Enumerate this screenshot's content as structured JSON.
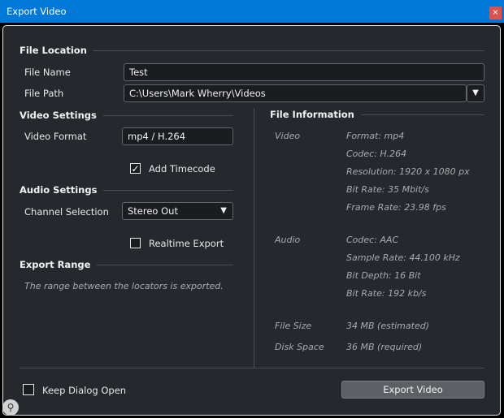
{
  "window": {
    "title": "Export Video",
    "close_icon": "×"
  },
  "file_location": {
    "heading": "File Location",
    "file_name_label": "File Name",
    "file_name_value": "Test",
    "file_path_label": "File Path",
    "file_path_value": "C:\\Users\\Mark Wherry\\Videos",
    "dropdown_icon": "▼"
  },
  "video_settings": {
    "heading": "Video Settings",
    "format_label": "Video Format",
    "format_value": "mp4 / H.264",
    "add_timecode_label": "Add Timecode",
    "add_timecode_checked": true,
    "check_glyph": "✓"
  },
  "audio_settings": {
    "heading": "Audio Settings",
    "channel_label": "Channel Selection",
    "channel_value": "Stereo Out",
    "dropdown_icon": "▼",
    "realtime_label": "Realtime Export",
    "realtime_checked": false
  },
  "export_range": {
    "heading": "Export Range",
    "description": "The range between the locators is exported."
  },
  "file_information": {
    "heading": "File Information",
    "video_label": "Video",
    "video_items": [
      "Format: mp4",
      "Codec: H.264",
      "Resolution: 1920 x 1080 px",
      "Bit Rate: 35 Mbit/s",
      "Frame Rate: 23.98 fps"
    ],
    "audio_label": "Audio",
    "audio_items": [
      "Codec: AAC",
      "Sample Rate: 44.100 kHz",
      "Bit Depth: 16 Bit",
      "Bit Rate: 192 kb/s"
    ],
    "file_size_label": "File Size",
    "file_size_value": "34 MB (estimated)",
    "disk_space_label": "Disk Space",
    "disk_space_value": "36 MB (required)"
  },
  "footer": {
    "keep_open_label": "Keep Dialog Open",
    "keep_open_checked": false,
    "export_button": "Export Video",
    "zoom_icon": "⚲"
  }
}
